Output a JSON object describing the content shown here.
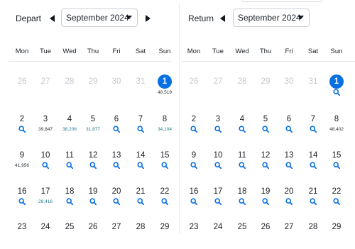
{
  "colors": {
    "accent": "#0770e3",
    "cheap_price": "#1c7a8f",
    "outside_day": "#c3c8ce"
  },
  "depart": {
    "label": "Depart",
    "month_select": "September 2024",
    "prev_icon": "triangle-left-icon",
    "next_icon": "triangle-right-icon",
    "weekdays": [
      "Mon",
      "Tue",
      "Wed",
      "Thu",
      "Fri",
      "Sat",
      "Sun"
    ],
    "weeks": [
      [
        {
          "day": "26",
          "outside": true
        },
        {
          "day": "27",
          "outside": true
        },
        {
          "day": "28",
          "outside": true
        },
        {
          "day": "29",
          "outside": true
        },
        {
          "day": "30",
          "outside": true
        },
        {
          "day": "31",
          "outside": true
        },
        {
          "day": "1",
          "selected": true,
          "price": "48,519"
        }
      ],
      [
        {
          "day": "2",
          "icon": "search-icon"
        },
        {
          "day": "3",
          "price": "39,847"
        },
        {
          "day": "4",
          "price": "38,206",
          "cheap": true
        },
        {
          "day": "5",
          "price": "31,877",
          "cheap": true
        },
        {
          "day": "6",
          "icon": "search-icon"
        },
        {
          "day": "7",
          "icon": "search-icon"
        },
        {
          "day": "8",
          "price": "34,104",
          "cheap": true
        }
      ],
      [
        {
          "day": "9",
          "price": "41,956"
        },
        {
          "day": "10",
          "icon": "search-icon"
        },
        {
          "day": "11",
          "icon": "search-icon"
        },
        {
          "day": "12",
          "icon": "search-icon"
        },
        {
          "day": "13",
          "icon": "search-icon"
        },
        {
          "day": "14",
          "icon": "search-icon"
        },
        {
          "day": "15",
          "icon": "search-icon"
        }
      ],
      [
        {
          "day": "16",
          "icon": "search-icon"
        },
        {
          "day": "17",
          "price": "29,416",
          "cheap": true
        },
        {
          "day": "18",
          "icon": "search-icon"
        },
        {
          "day": "19",
          "icon": "search-icon"
        },
        {
          "day": "20",
          "icon": "search-icon"
        },
        {
          "day": "21",
          "icon": "search-icon"
        },
        {
          "day": "22",
          "icon": "search-icon"
        }
      ],
      [
        {
          "day": "23"
        },
        {
          "day": "24"
        },
        {
          "day": "25"
        },
        {
          "day": "26"
        },
        {
          "day": "27"
        },
        {
          "day": "28"
        },
        {
          "day": "29"
        }
      ]
    ]
  },
  "return": {
    "label": "Return",
    "month_select": "September 2024",
    "prev_icon": "triangle-left-icon",
    "next_icon": "triangle-right-icon",
    "weekdays": [
      "Mon",
      "Tue",
      "Wed",
      "Thu",
      "Fri",
      "Sat",
      "Sun"
    ],
    "weeks": [
      [
        {
          "day": "26",
          "outside": true
        },
        {
          "day": "27",
          "outside": true
        },
        {
          "day": "28",
          "outside": true
        },
        {
          "day": "29",
          "outside": true
        },
        {
          "day": "30",
          "outside": true
        },
        {
          "day": "31",
          "outside": true
        },
        {
          "day": "1",
          "selected": true,
          "icon": "search-icon"
        }
      ],
      [
        {
          "day": "2",
          "icon": "search-icon"
        },
        {
          "day": "3",
          "icon": "search-icon"
        },
        {
          "day": "4",
          "icon": "search-icon"
        },
        {
          "day": "5",
          "icon": "search-icon"
        },
        {
          "day": "6",
          "icon": "search-icon"
        },
        {
          "day": "7",
          "icon": "search-icon"
        },
        {
          "day": "8",
          "price": "48,402"
        }
      ],
      [
        {
          "day": "9",
          "icon": "search-icon"
        },
        {
          "day": "10",
          "icon": "search-icon"
        },
        {
          "day": "11",
          "icon": "search-icon"
        },
        {
          "day": "12",
          "icon": "search-icon"
        },
        {
          "day": "13",
          "icon": "search-icon"
        },
        {
          "day": "14",
          "icon": "search-icon"
        },
        {
          "day": "15",
          "icon": "search-icon"
        }
      ],
      [
        {
          "day": "16",
          "icon": "search-icon"
        },
        {
          "day": "17",
          "icon": "search-icon"
        },
        {
          "day": "18",
          "icon": "search-icon"
        },
        {
          "day": "19",
          "icon": "search-icon"
        },
        {
          "day": "20",
          "icon": "search-icon"
        },
        {
          "day": "21",
          "icon": "search-icon"
        },
        {
          "day": "22",
          "icon": "search-icon"
        }
      ],
      [
        {
          "day": "23"
        },
        {
          "day": "24"
        },
        {
          "day": "25"
        },
        {
          "day": "26"
        },
        {
          "day": "27"
        },
        {
          "day": "28"
        },
        {
          "day": "29"
        }
      ]
    ]
  }
}
